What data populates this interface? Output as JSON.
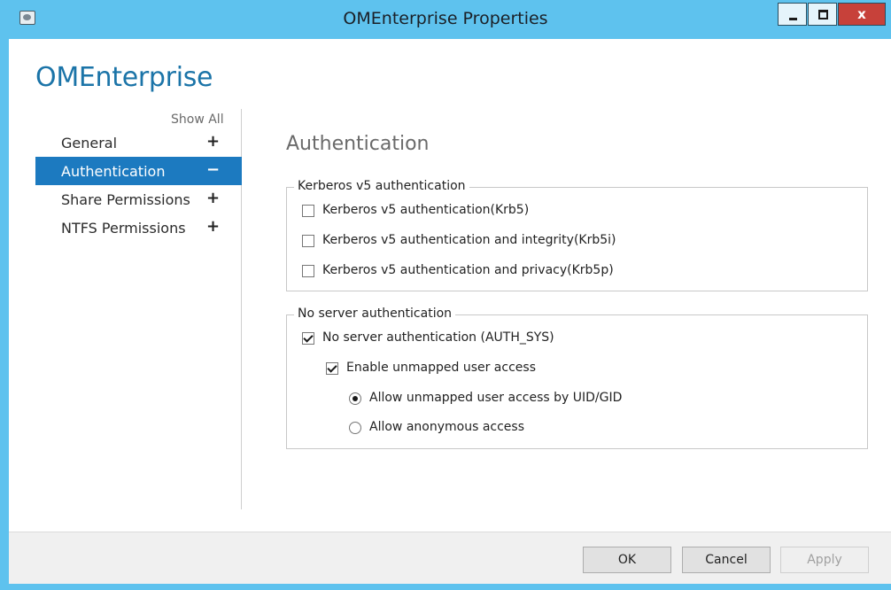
{
  "window": {
    "title": "OMEnterprise Properties",
    "close_glyph": "x"
  },
  "app_title": "OMEnterprise",
  "show_all": "Show All",
  "nav": [
    {
      "label": "General",
      "toggle": "+",
      "active": false
    },
    {
      "label": "Authentication",
      "toggle": "−",
      "active": true
    },
    {
      "label": "Share Permissions",
      "toggle": "+",
      "active": false
    },
    {
      "label": "NTFS Permissions",
      "toggle": "+",
      "active": false
    }
  ],
  "section_title": "Authentication",
  "kerberos": {
    "legend": "Kerberos v5 authentication",
    "options": [
      {
        "label": "Kerberos v5 authentication(Krb5)",
        "checked": false
      },
      {
        "label": "Kerberos v5 authentication and integrity(Krb5i)",
        "checked": false
      },
      {
        "label": "Kerberos v5 authentication and privacy(Krb5p)",
        "checked": false
      }
    ]
  },
  "no_server": {
    "legend": "No server authentication",
    "auth_sys": {
      "label": "No server authentication (AUTH_SYS)",
      "checked": true
    },
    "unmapped": {
      "label": "Enable unmapped user access",
      "checked": true
    },
    "radio_uid": {
      "label": "Allow unmapped user access by UID/GID",
      "checked": true
    },
    "radio_anon": {
      "label": "Allow anonymous access",
      "checked": false
    }
  },
  "footer": {
    "ok": "OK",
    "cancel": "Cancel",
    "apply": "Apply"
  },
  "colors": {
    "frame": "#5ec2ee",
    "accent": "#1c7ac0",
    "app_title": "#1b74a8",
    "close_button": "#c7413a"
  }
}
